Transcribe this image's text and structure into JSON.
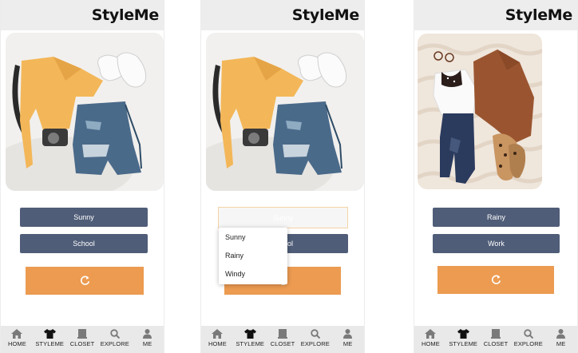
{
  "app_title": "StyleMe",
  "colors": {
    "header_bg": "#ededed",
    "filter_button": "#4f5d78",
    "refresh_button": "#ec9b51",
    "tab_bar_bg": "#e9e9e9"
  },
  "screens": [
    {
      "photo": "outfit-mustard-top-denim-shorts",
      "filters": {
        "weather": "Sunny",
        "occasion": "School"
      },
      "refresh_icon": "refresh-icon"
    },
    {
      "photo": "outfit-mustard-top-denim-shorts",
      "filters": {
        "weather_placeholder": "Sunny",
        "occasion_partial": "ol",
        "dropdown_options": [
          "Sunny",
          "Rainy",
          "Windy"
        ]
      },
      "refresh_icon": "refresh-icon"
    },
    {
      "photo": "outfit-brown-sweater-jeans-flats",
      "filters": {
        "weather": "Rainy",
        "occasion": "Work"
      },
      "refresh_icon": "refresh-icon"
    }
  ],
  "tabs": [
    {
      "label": "HOME",
      "icon": "home-icon"
    },
    {
      "label": "STYLEME",
      "icon": "tshirt-icon"
    },
    {
      "label": "CLOSET",
      "icon": "closet-icon"
    },
    {
      "label": "EXPLORE",
      "icon": "search-icon"
    },
    {
      "label": "ME",
      "icon": "person-icon"
    }
  ]
}
